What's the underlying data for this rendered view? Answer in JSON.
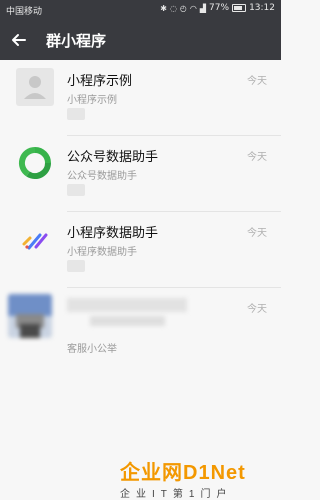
{
  "status_bar": {
    "carrier": "中国移动",
    "battery_text": "77%",
    "time": "13:12",
    "battery_level": 0.77
  },
  "header": {
    "title": "群小程序",
    "back_icon": "arrow-left-icon"
  },
  "items": [
    {
      "name": "小程序示例",
      "subtitle": "小程序示例",
      "time": "今天",
      "icon": "person-placeholder-icon"
    },
    {
      "name": "公众号数据助手",
      "subtitle": "公众号数据助手",
      "time": "今天",
      "icon": "green-swirl-icon"
    },
    {
      "name": "小程序数据助手",
      "subtitle": "小程序数据助手",
      "time": "今天",
      "icon": "colored-strokes-icon"
    },
    {
      "name": "",
      "subtitle": "客服小公举",
      "time": "今天",
      "icon": "blurred-avatar-icon"
    }
  ],
  "watermark": {
    "logo_text": "企业网D1Net",
    "tagline": "企业IT第1门户"
  },
  "colors": {
    "header_bg": "#393a3f",
    "body_bg": "#f7f7f7",
    "watermark_orange": "#f39800",
    "watermark_red": "#e60012"
  }
}
